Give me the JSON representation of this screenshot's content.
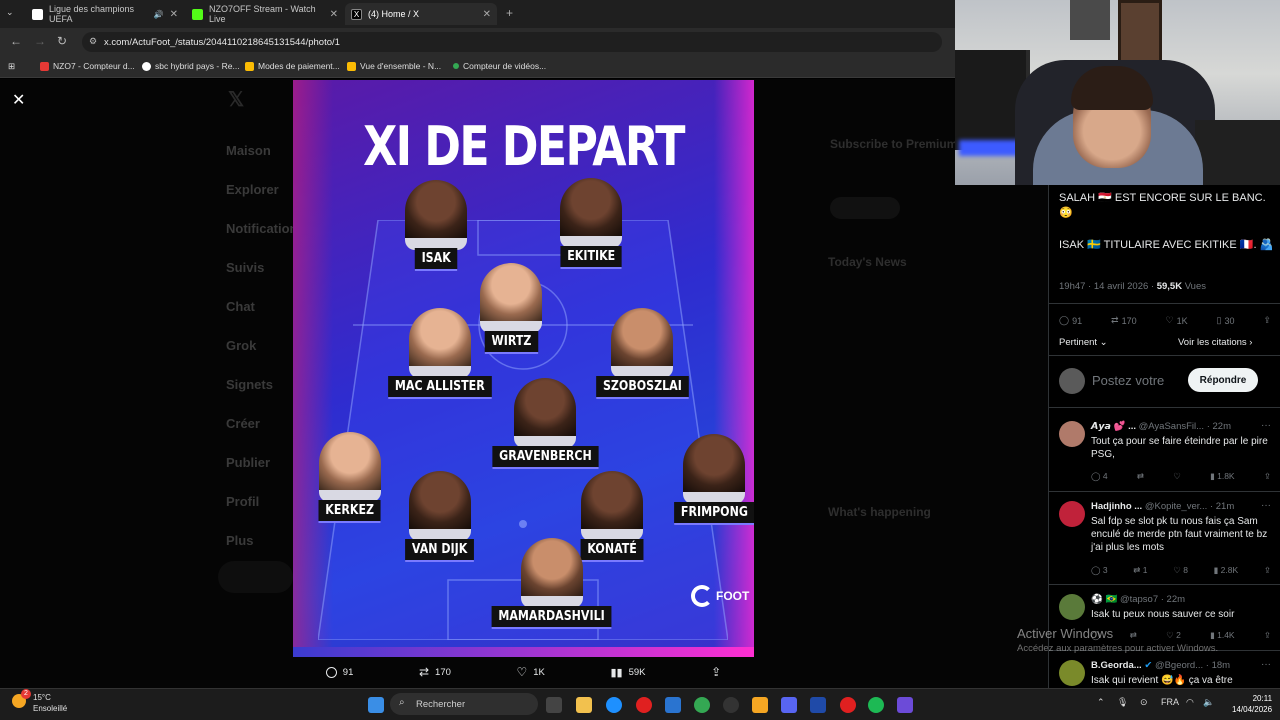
{
  "browser": {
    "tabs": [
      {
        "label": "Ligue des champions UEFA",
        "color": "#ffffff"
      },
      {
        "label": "NZO7OFF Stream - Watch Live",
        "color": "#53fc18"
      },
      {
        "label": "(4) Home / X",
        "color": "#ffffff"
      }
    ],
    "url": "x.com/ActuFoot_/status/2044110218645131544/photo/1",
    "bookmarks": [
      {
        "label": "NZO7 - Compteur d...",
        "color": "#e53935"
      },
      {
        "label": "sbc hybrid pays - Re...",
        "color": "#ffffff"
      },
      {
        "label": "Modes de paiement...",
        "color": "#fbbc04"
      },
      {
        "label": "Vue d'ensemble - N...",
        "color": "#fbbc04"
      },
      {
        "label": "Compteur de vidéos...",
        "color": "#34a853"
      }
    ]
  },
  "poster": {
    "title": "XI DE DEPART",
    "brand": "FOOT",
    "players": [
      {
        "name": "ISAK",
        "tone": "dark"
      },
      {
        "name": "EKITIKE",
        "tone": "dark"
      },
      {
        "name": "WIRTZ",
        "tone": "light"
      },
      {
        "name": "MAC ALLISTER",
        "tone": "light"
      },
      {
        "name": "SZOBOSZLAI",
        "tone": "mid"
      },
      {
        "name": "GRAVENBERCH",
        "tone": "dark"
      },
      {
        "name": "KERKEZ",
        "tone": "light"
      },
      {
        "name": "FRIMPONG",
        "tone": "dark"
      },
      {
        "name": "VAN DIJK",
        "tone": "dark"
      },
      {
        "name": "KONATÉ",
        "tone": "dark"
      },
      {
        "name": "MAMARDASHVILI",
        "tone": "mid"
      }
    ]
  },
  "image_actions": {
    "replies": "91",
    "reposts": "170",
    "likes": "1K",
    "views": "59K"
  },
  "post": {
    "line1": "SALAH 🇪🇬 EST ENCORE SUR LE BANC. 😳",
    "line2": "ISAK 🇸🇪 TITULAIRE AVEC EKITIKE 🇫🇷. 🫂",
    "time": "19h47 · 14 avril 2026 · ",
    "views": "59,5K",
    "views_label": " Vues",
    "stats": {
      "replies": "91",
      "reposts": "170",
      "likes": "1K",
      "bookmarks": "30"
    },
    "sort": "Pertinent",
    "quotes_link": "Voir les citations",
    "compose_placeholder": "Postez votre",
    "reply_button": "Répondre"
  },
  "replies": [
    {
      "name": "𝘼𝙮𝙖 💕 ...",
      "handle": "@AyaSansFil...",
      "time": "· 22m",
      "text": "Tout ça pour se faire éteindre par le pire PSG,",
      "stats": [
        "4",
        "",
        "",
        "1.8K"
      ],
      "avatar_color": "#b07a6a"
    },
    {
      "name": "Hadjinho ...",
      "handle": "@Kopite_ver...",
      "time": "· 21m",
      "text": "Sal fdp se slot pk tu nous fais ça Sam enculé de merde ptn faut vraiment te bz j'ai plus les mots",
      "stats": [
        "3",
        "1",
        "8",
        "2.8K"
      ],
      "avatar_color": "#c0223a"
    },
    {
      "name": "⚽ 🇧🇷",
      "handle": "@tapso7",
      "time": "· 22m",
      "text": "Isak tu peux nous sauver ce soir",
      "stats": [
        "",
        "",
        "2",
        "1.4K"
      ],
      "avatar_color": "#5a7a3a"
    },
    {
      "name": "B.Georda...",
      "handle": "@Bgeord...",
      "time": "· 18m",
      "text": "Isak qui revient 😅🔥 ça va être",
      "stats": [],
      "avatar_color": "#7a8a2a"
    }
  ],
  "windows_watermark": {
    "title": "Activer Windows",
    "subtitle": "Accédez aux paramètres pour activer Windows."
  },
  "taskbar": {
    "weather_temp": "15°C",
    "weather_desc": "Ensoleillé",
    "search_placeholder": "Rechercher",
    "lang": "FRA",
    "time": "20:11",
    "date": "14/04/2026",
    "notif_badge": "2"
  },
  "x_background": {
    "sidebar": [
      "Maison",
      "Explorer",
      "Notifications",
      "Suivis",
      "Chat",
      "Grok",
      "Signets",
      "Créer",
      "Publier",
      "Profil",
      "Plus"
    ],
    "right_headers": [
      "Subscribe to Premium",
      "Today's News",
      "What's happening"
    ]
  }
}
